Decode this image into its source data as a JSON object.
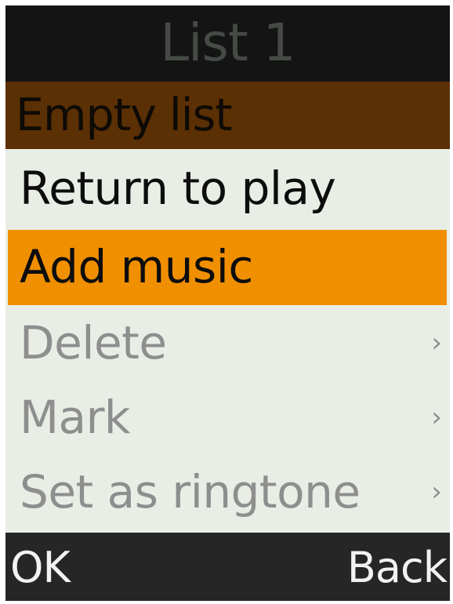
{
  "title": "List 1",
  "subheader": "Empty list",
  "menu": {
    "items": [
      {
        "label": "Return to play",
        "state": "normal",
        "has_submenu": false
      },
      {
        "label": "Add music",
        "state": "selected",
        "has_submenu": false
      },
      {
        "label": "Delete",
        "state": "disabled",
        "has_submenu": true,
        "chevron": "›"
      },
      {
        "label": "Mark",
        "state": "disabled",
        "has_submenu": true,
        "chevron": "›"
      },
      {
        "label": "Set as ringtone",
        "state": "disabled",
        "has_submenu": true,
        "chevron": "›"
      }
    ]
  },
  "softkeys": {
    "left": "OK",
    "right": "Back"
  },
  "colors": {
    "title_bg": "#141414",
    "title_text": "#454a45",
    "subheader_bg": "#5b3004",
    "menu_bg": "#e8eee6",
    "selected_bg": "#f08f00",
    "disabled_text": "#8e8e8e",
    "softkey_bg": "#262626",
    "softkey_text": "#f2f2f2"
  }
}
